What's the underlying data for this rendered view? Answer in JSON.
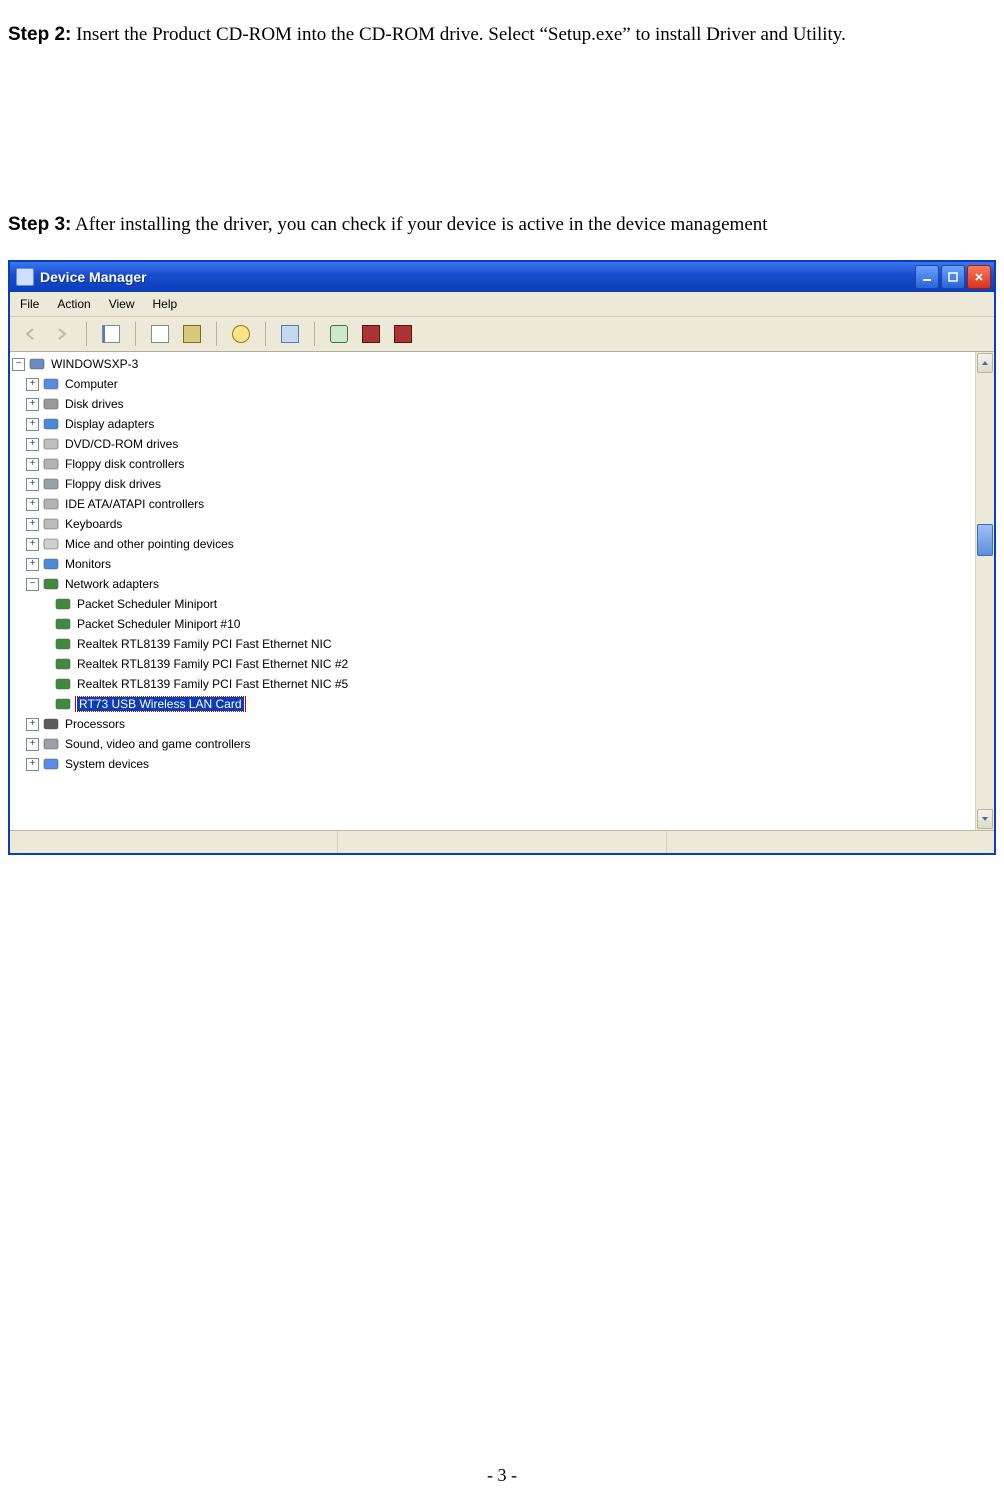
{
  "step2": {
    "label": "Step 2:",
    "text": " Insert the Product CD-ROM into the CD-ROM drive. Select “Setup.exe” to install Driver and Utility."
  },
  "step3": {
    "label": "Step 3:",
    "text": " After installing the driver, you can check if your device is active in the device management"
  },
  "footer": "- 3 -",
  "window": {
    "title": "Device Manager",
    "menu": [
      "File",
      "Action",
      "View",
      "Help"
    ],
    "root": "WINDOWSXP-3",
    "nodes": [
      {
        "label": "Computer",
        "icon": "computer"
      },
      {
        "label": "Disk drives",
        "icon": "disk"
      },
      {
        "label": "Display adapters",
        "icon": "display"
      },
      {
        "label": "DVD/CD-ROM drives",
        "icon": "dvd"
      },
      {
        "label": "Floppy disk controllers",
        "icon": "floppyctl"
      },
      {
        "label": "Floppy disk drives",
        "icon": "floppy"
      },
      {
        "label": "IDE ATA/ATAPI controllers",
        "icon": "ide"
      },
      {
        "label": "Keyboards",
        "icon": "keyboard"
      },
      {
        "label": "Mice and other pointing devices",
        "icon": "mouse"
      },
      {
        "label": "Monitors",
        "icon": "monitor"
      }
    ],
    "network": {
      "label": "Network adapters",
      "children": [
        "Packet Scheduler Miniport",
        "Packet Scheduler Miniport #10",
        "Realtek RTL8139 Family PCI Fast Ethernet NIC",
        "Realtek RTL8139 Family PCI Fast Ethernet NIC #2",
        "Realtek RTL8139 Family PCI Fast Ethernet NIC #5",
        "RT73 USB Wireless LAN Card"
      ]
    },
    "tail": [
      {
        "label": "Processors",
        "icon": "processor"
      },
      {
        "label": "Sound, video and game controllers",
        "icon": "sound"
      },
      {
        "label": "System devices",
        "icon": "system"
      }
    ]
  }
}
